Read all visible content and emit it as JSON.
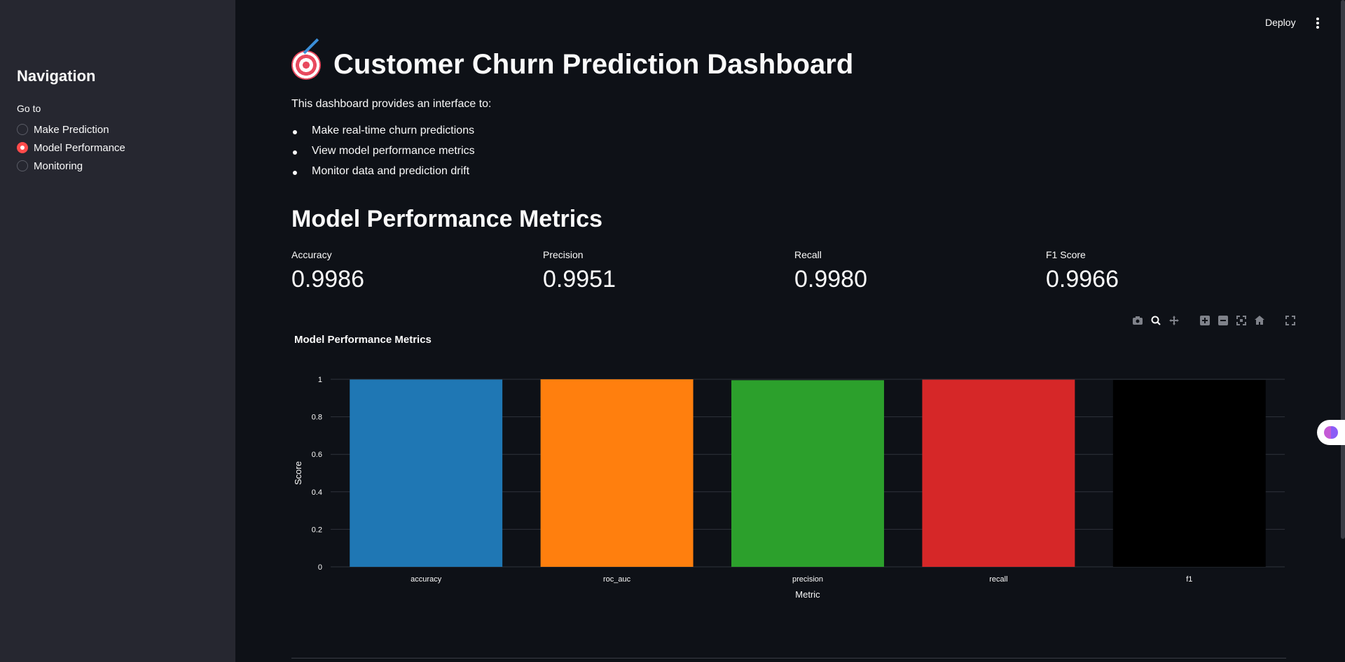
{
  "sidebar": {
    "title": "Navigation",
    "radio_label": "Go to",
    "options": [
      {
        "label": "Make Prediction",
        "selected": false
      },
      {
        "label": "Model Performance",
        "selected": true
      },
      {
        "label": "Monitoring",
        "selected": false
      }
    ]
  },
  "topbar": {
    "deploy_label": "Deploy",
    "menu_icon": "vertical-dots-icon"
  },
  "header": {
    "icon": "target-icon",
    "title": "Customer Churn Prediction Dashboard",
    "intro": "This dashboard provides an interface to:",
    "bullets": [
      "Make real-time churn predictions",
      "View model performance metrics",
      "Monitor data and prediction drift"
    ]
  },
  "section": {
    "title": "Model Performance Metrics"
  },
  "metrics": [
    {
      "label": "Accuracy",
      "value": "0.9986"
    },
    {
      "label": "Precision",
      "value": "0.9951"
    },
    {
      "label": "Recall",
      "value": "0.9980"
    },
    {
      "label": "F1 Score",
      "value": "0.9966"
    }
  ],
  "chart_toolbar": [
    "camera-icon",
    "zoom-icon",
    "pan-icon",
    "zoom-in-icon",
    "zoom-out-icon",
    "autoscale-icon",
    "reset-axes-icon",
    "fullscreen-icon"
  ],
  "chart_data": {
    "type": "bar",
    "title": "Model Performance Metrics",
    "xlabel": "Metric",
    "ylabel": "Score",
    "categories": [
      "accuracy",
      "roc_auc",
      "precision",
      "recall",
      "f1"
    ],
    "values": [
      0.9986,
      0.9997,
      0.9951,
      0.998,
      0.9966
    ],
    "colors": [
      "#1f77b4",
      "#ff7f0e",
      "#2ca02c",
      "#d62728",
      "#000000"
    ],
    "ylim": [
      0,
      1
    ],
    "yticks": [
      "0",
      "0.2",
      "0.4",
      "0.6",
      "0.8",
      "1"
    ],
    "grid": true,
    "legend": false
  },
  "colors": {
    "accent": "#ff4b4b",
    "background": "#0e1117",
    "sidebar": "#262730"
  }
}
